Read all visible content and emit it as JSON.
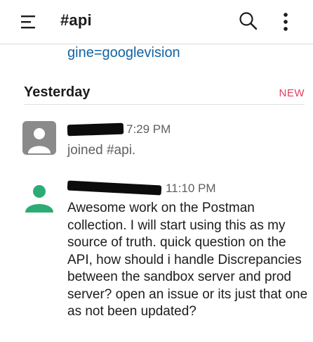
{
  "header": {
    "channel": "#api",
    "icons": {
      "menu": "hamburger-menu-icon",
      "search": "search-icon",
      "more": "more-vertical-icon"
    }
  },
  "link_fragment": "gine=googlevision",
  "divider": {
    "label": "Yesterday",
    "badge": "NEW"
  },
  "messages": [
    {
      "time": "7:29 PM",
      "text": "joined #api.",
      "avatar": "gray-default-avatar"
    },
    {
      "time": "11:10 PM",
      "text": "Awesome work on the Postman collection.  I will start using this as my source of truth.  quick question on the API, how should i handle Discrepancies between the sandbox server and prod server? open an issue or its just that one as not been updated?",
      "avatar": "green-default-avatar"
    }
  ],
  "colors": {
    "accent_link": "#1264a3",
    "badge_new": "#e0405e",
    "avatar_gray": "#8a8a8a",
    "avatar_green": "#2bac76"
  }
}
